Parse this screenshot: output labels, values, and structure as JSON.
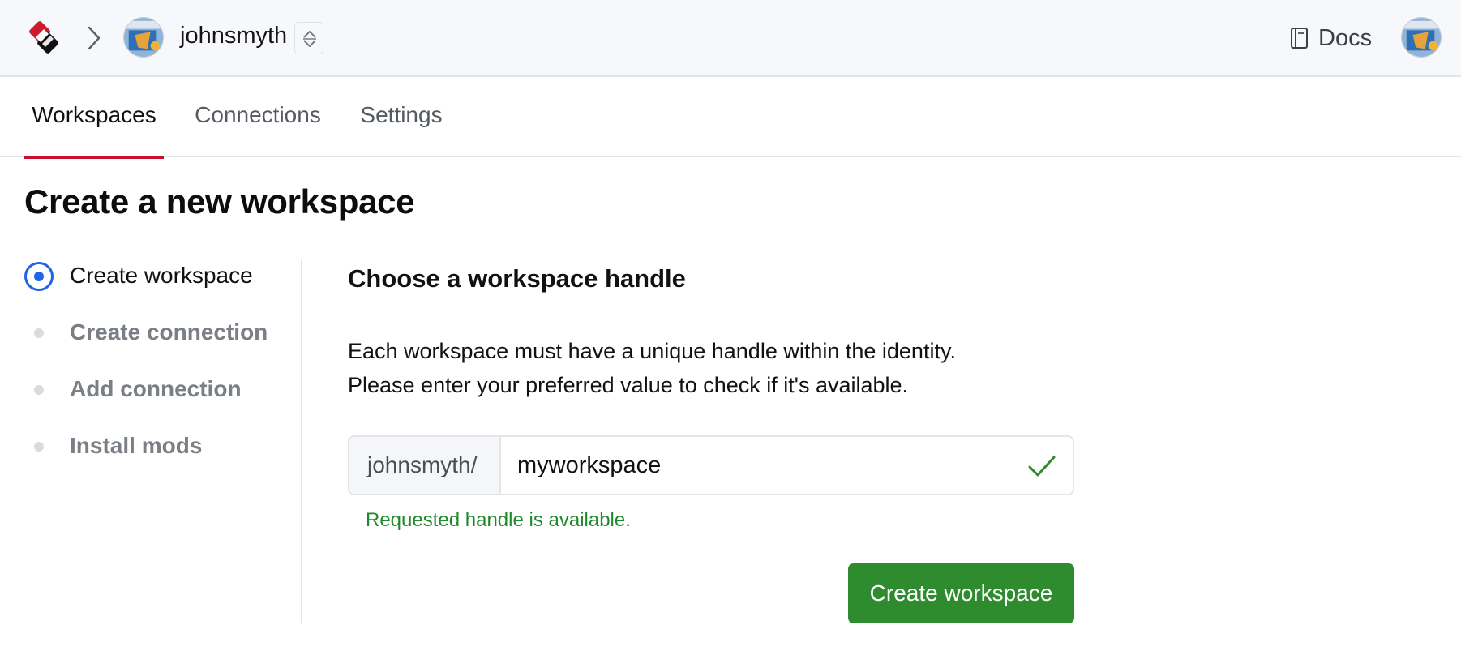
{
  "header": {
    "logo_icon": "app-logo-icon",
    "breadcrumb_separator_icon": "chevron-right-icon",
    "identity": {
      "name": "johnsmyth",
      "switcher_icon": "chevron-up-down-icon",
      "avatar_icon": "avatar-icon"
    },
    "docs": {
      "label": "Docs",
      "icon": "book-icon"
    },
    "user_avatar_icon": "avatar-icon"
  },
  "tabs": [
    {
      "label": "Workspaces",
      "active": true
    },
    {
      "label": "Connections",
      "active": false
    },
    {
      "label": "Settings",
      "active": false
    }
  ],
  "page_title": "Create a new workspace",
  "steps": [
    {
      "label": "Create workspace",
      "state": "current"
    },
    {
      "label": "Create connection",
      "state": "pending"
    },
    {
      "label": "Add connection",
      "state": "pending"
    },
    {
      "label": "Install mods",
      "state": "pending"
    }
  ],
  "form": {
    "title": "Choose a workspace handle",
    "description_lines": [
      "Each workspace must have a unique handle within the identity.",
      "Please enter your preferred value to check if it's available."
    ],
    "handle_prefix": "johnsmyth/",
    "handle_value": "myworkspace",
    "validation_icon": "check-icon",
    "helper_text": "Requested handle is available.",
    "submit_label": "Create workspace"
  },
  "colors": {
    "accent_red": "#c8102e",
    "step_active_blue": "#1f63e6",
    "success_green": "#2e8b2e",
    "helper_green": "#1f8a2b"
  }
}
